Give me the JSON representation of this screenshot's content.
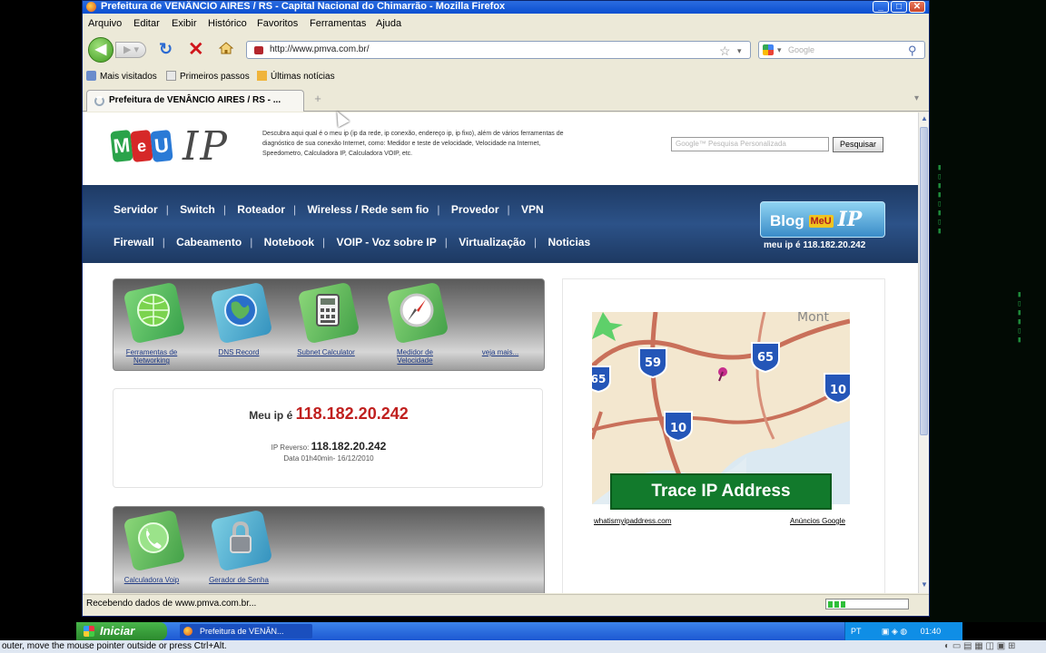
{
  "window": {
    "title": "Prefeitura de VENÂNCIO AIRES / RS - Capital Nacional do Chimarrão - Mozilla Firefox"
  },
  "menubar": [
    "Arquivo",
    "Editar",
    "Exibir",
    "Histórico",
    "Favoritos",
    "Ferramentas",
    "Ajuda"
  ],
  "navbar": {
    "url": "http://www.pmva.com.br/",
    "search_placeholder": "Google"
  },
  "bookmarks": [
    "Mais visitados",
    "Primeiros passos",
    "Últimas notícias"
  ],
  "tab": {
    "label": "Prefeitura de VENÂNCIO AIRES / RS - ...",
    "new_tab": "+"
  },
  "page": {
    "logo": {
      "m": "M",
      "e": "e",
      "u": "U",
      "ip": "IP"
    },
    "description": "Descubra aqui qual é o meu ip (ip da rede, ip conexão, endereço ip, ip fixo), além de vários ferramentas de diagnóstico de sua conexão Internet, como: Medidor e teste de velocidade, Velocidade na Internet, Speedometro, Calculadora IP, Calculadora VOIP, etc.",
    "search": {
      "placeholder": "Google™ Pesquisa Personalizada",
      "button": "Pesquisar"
    },
    "nav_row1": [
      "Servidor",
      "Switch",
      "Roteador",
      "Wireless / Rede sem fio",
      "Provedor",
      "VPN"
    ],
    "nav_row2": [
      "Firewall",
      "Cabeamento",
      "Notebook",
      "VOIP - Voz sobre IP",
      "Virtualização",
      "Noticias"
    ],
    "blog": {
      "blog": "Blog",
      "meu": "MeU",
      "ip": "IP",
      "my_ip": "meu ip é 118.182.20.242"
    },
    "tools1": [
      {
        "label": "Ferramentas de Networking",
        "icon": "globe-green-icon"
      },
      {
        "label": "DNS Record",
        "icon": "globe-blue-icon"
      },
      {
        "label": "Subnet Calculator",
        "icon": "calculator-icon"
      },
      {
        "label": "Medidor de Velocidade",
        "icon": "compass-icon"
      },
      {
        "label": "veja mais...",
        "icon": ""
      }
    ],
    "ipbox": {
      "prefix": "Meu ip é",
      "ip": "118.182.20.242",
      "reverse_label": "IP Reverso:",
      "reverse_value": "118.182.20.242",
      "date": "Data 01h40min- 16/12/2010"
    },
    "tools2": [
      {
        "label": "Calculadora Voip",
        "icon": "phone-icon"
      },
      {
        "label": "Gerador de Senha",
        "icon": "padlock-icon"
      }
    ],
    "ad": {
      "map_text": "Mont",
      "shields": [
        "59",
        "65",
        "65",
        "10",
        "10"
      ],
      "trace_button": "Trace IP Address",
      "link": "whatismyipaddress.com",
      "google": "Anúncios Google"
    }
  },
  "statusbar": {
    "text": "Recebendo dados de www.pmva.com.br..."
  },
  "taskbar": {
    "start": "Iniciar",
    "item": "Prefeitura de VENÂN...",
    "tray_lang": "PT",
    "tray_time": "01:40"
  },
  "vm_hint": "outer, move the mouse pointer outside or press Ctrl+Alt.",
  "colors": {
    "nav_band": "#2c5288",
    "ip_red": "#c0201f",
    "trace_green": "#127a2c",
    "logo_m": "#2aa34a",
    "logo_e": "#d62828",
    "logo_u": "#2a7ad6"
  }
}
